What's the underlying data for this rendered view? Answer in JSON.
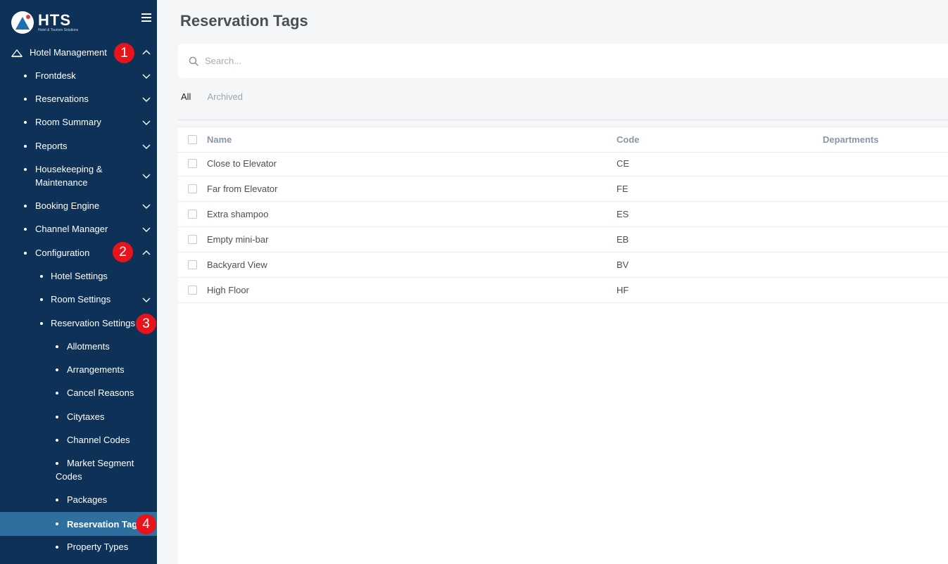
{
  "sidebar": {
    "logo": {
      "title": "HTS",
      "subtitle": "Hotel & Tourism Solutions"
    },
    "items": [
      {
        "label": "Hotel Management"
      },
      {
        "label": "Frontdesk"
      },
      {
        "label": "Reservations"
      },
      {
        "label": "Room Summary"
      },
      {
        "label": "Reports"
      },
      {
        "label": "Housekeeping &"
      },
      {
        "label": "Maintenance"
      },
      {
        "label": "Booking Engine"
      },
      {
        "label": "Channel Manager"
      },
      {
        "label": "Configuration"
      },
      {
        "label": "Hotel Settings"
      },
      {
        "label": "Room Settings"
      },
      {
        "label": "Reservation Settings"
      },
      {
        "label": "Allotments"
      },
      {
        "label": "Arrangements"
      },
      {
        "label": "Cancel Reasons"
      },
      {
        "label": "Citytaxes"
      },
      {
        "label": "Channel Codes"
      },
      {
        "label": "Market Segment"
      },
      {
        "label": "Codes"
      },
      {
        "label": "Packages"
      },
      {
        "label": "Reservation Tags"
      },
      {
        "label": "Property Types"
      }
    ],
    "badges": [
      "1",
      "2",
      "3",
      "4"
    ]
  },
  "main": {
    "title": "Reservation Tags",
    "search_placeholder": "Search...",
    "tabs": [
      {
        "label": "All"
      },
      {
        "label": "Archived"
      }
    ],
    "table": {
      "columns": [
        "Name",
        "Code",
        "Departments"
      ],
      "rows": [
        {
          "name": "Close to Elevator",
          "code": "CE"
        },
        {
          "name": "Far from Elevator",
          "code": "FE"
        },
        {
          "name": "Extra shampoo",
          "code": "ES"
        },
        {
          "name": "Empty mini-bar",
          "code": "EB"
        },
        {
          "name": "Backyard View",
          "code": "BV"
        },
        {
          "name": "High Floor",
          "code": "HF"
        }
      ]
    }
  },
  "colors": {
    "sidebar_bg": "#0d3157",
    "active_item_bg": "#2e6f9e",
    "badge_red": "#e8141b",
    "content_bg": "#f5f6f8"
  }
}
